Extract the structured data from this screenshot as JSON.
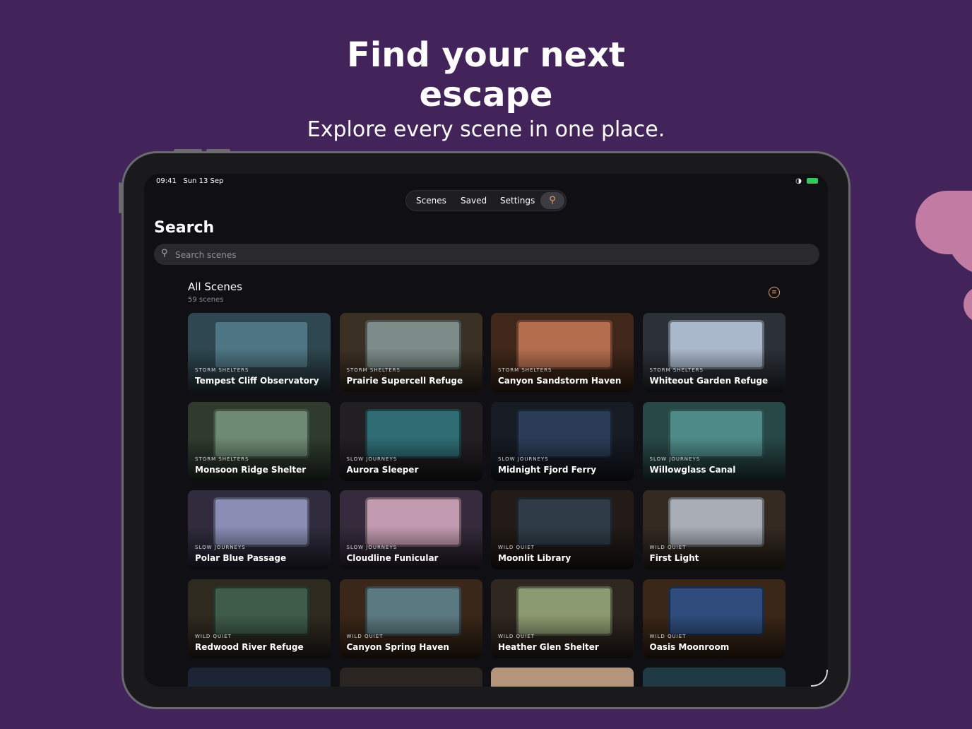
{
  "promo": {
    "headline_line1": "Find your next",
    "headline_line2": "escape",
    "subheadline": "Explore every scene in one place."
  },
  "status_bar": {
    "time": "09:41",
    "date": "Sun 13 Sep",
    "icons": [
      "wifi-icon",
      "battery-icon"
    ]
  },
  "nav": {
    "tabs": [
      "Scenes",
      "Saved",
      "Settings"
    ],
    "search_icon": "search-icon"
  },
  "search": {
    "title": "Search",
    "placeholder": "Search scenes"
  },
  "section": {
    "title": "All Scenes",
    "count": "59 scenes",
    "filter_icon": "filter-icon"
  },
  "scenes": [
    {
      "category": "STORM SHELTERS",
      "title": "Tempest Cliff Observatory",
      "color": "#2f4750",
      "window": "#4f7684"
    },
    {
      "category": "STORM SHELTERS",
      "title": "Prairie Supercell Refuge",
      "color": "#3b3024",
      "window": "#7d8c88"
    },
    {
      "category": "STORM SHELTERS",
      "title": "Canyon Sandstorm Haven",
      "color": "#3f2719",
      "window": "#b46e4e"
    },
    {
      "category": "STORM SHELTERS",
      "title": "Whiteout Garden Refuge",
      "color": "#2c3138",
      "window": "#aab8cb"
    },
    {
      "category": "STORM SHELTERS",
      "title": "Monsoon Ridge Shelter",
      "color": "#2e3b2d",
      "window": "#6e8a74"
    },
    {
      "category": "SLOW JOURNEYS",
      "title": "Aurora Sleeper",
      "color": "#221f22",
      "window": "#2f6c73"
    },
    {
      "category": "SLOW JOURNEYS",
      "title": "Midnight Fjord Ferry",
      "color": "#161b24",
      "window": "#2a3c56"
    },
    {
      "category": "SLOW JOURNEYS",
      "title": "Willowglass Canal",
      "color": "#284847",
      "window": "#4e8a88"
    },
    {
      "category": "SLOW JOURNEYS",
      "title": "Polar Blue Passage",
      "color": "#302c3e",
      "window": "#8a8eb4"
    },
    {
      "category": "SLOW JOURNEYS",
      "title": "Cloudline Funicular",
      "color": "#352b3c",
      "window": "#c39bb1"
    },
    {
      "category": "WILD QUIET",
      "title": "Moonlit Library",
      "color": "#231b17",
      "window": "#2f3c48"
    },
    {
      "category": "WILD QUIET",
      "title": "First Light",
      "color": "#352a22",
      "window": "#a9aeb6"
    },
    {
      "category": "WILD QUIET",
      "title": "Redwood River Refuge",
      "color": "#2f2a20",
      "window": "#3f5b49"
    },
    {
      "category": "WILD QUIET",
      "title": "Canyon Spring Haven",
      "color": "#3b2719",
      "window": "#5b7980"
    },
    {
      "category": "WILD QUIET",
      "title": "Heather Glen Shelter",
      "color": "#302720",
      "window": "#8c9a71"
    },
    {
      "category": "WILD QUIET",
      "title": "Oasis Moonroom",
      "color": "#3b2718",
      "window": "#2f4c7c"
    }
  ],
  "partial_row": [
    {
      "color": "#1d2534"
    },
    {
      "color": "#2b2521"
    },
    {
      "color": "#b4947a"
    },
    {
      "color": "#1f3a44"
    }
  ]
}
